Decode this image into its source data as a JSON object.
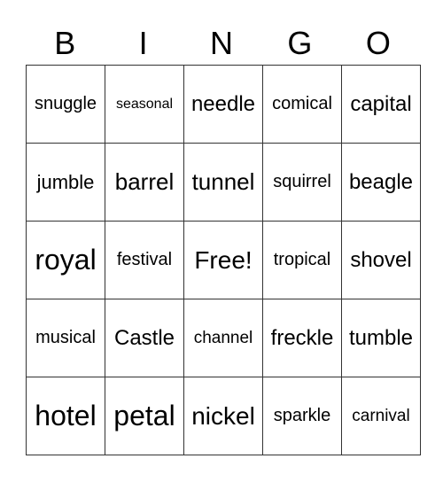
{
  "header": [
    "B",
    "I",
    "N",
    "G",
    "O"
  ],
  "rows": [
    [
      {
        "text": "snuggle",
        "size": 20
      },
      {
        "text": "seasonal",
        "size": 16
      },
      {
        "text": "needle",
        "size": 24
      },
      {
        "text": "comical",
        "size": 20
      },
      {
        "text": "capital",
        "size": 24
      }
    ],
    [
      {
        "text": "jumble",
        "size": 22
      },
      {
        "text": "barrel",
        "size": 26
      },
      {
        "text": "tunnel",
        "size": 26
      },
      {
        "text": "squirrel",
        "size": 20
      },
      {
        "text": "beagle",
        "size": 24
      }
    ],
    [
      {
        "text": "royal",
        "size": 32
      },
      {
        "text": "festival",
        "size": 20
      },
      {
        "text": "Free!",
        "size": 28
      },
      {
        "text": "tropical",
        "size": 20
      },
      {
        "text": "shovel",
        "size": 24
      }
    ],
    [
      {
        "text": "musical",
        "size": 20
      },
      {
        "text": "Castle",
        "size": 24
      },
      {
        "text": "channel",
        "size": 19
      },
      {
        "text": "freckle",
        "size": 24
      },
      {
        "text": "tumble",
        "size": 24
      }
    ],
    [
      {
        "text": "hotel",
        "size": 32
      },
      {
        "text": "petal",
        "size": 32
      },
      {
        "text": "nickel",
        "size": 28
      },
      {
        "text": "sparkle",
        "size": 20
      },
      {
        "text": "carnival",
        "size": 19
      }
    ]
  ]
}
